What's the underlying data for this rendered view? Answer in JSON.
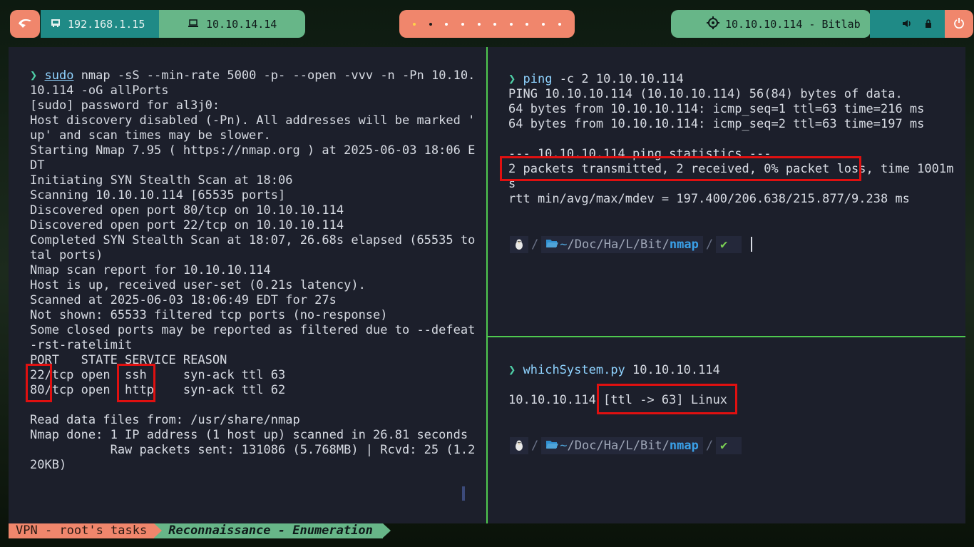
{
  "topbar": {
    "logo_icon": "kali-dragon-icon",
    "local_ip": "192.168.1.15",
    "local_icon": "network-card-icon",
    "vpn_ip": "10.10.14.14",
    "vpn_icon": "laptop-icon",
    "target": "10.10.10.114 - Bitlab",
    "target_icon": "crosshair-icon",
    "workspaces": [
      {
        "state": "active"
      },
      {
        "state": "current"
      },
      {
        "state": "empty"
      },
      {
        "state": "empty"
      },
      {
        "state": "empty"
      },
      {
        "state": "empty"
      },
      {
        "state": "empty"
      },
      {
        "state": "empty"
      },
      {
        "state": "empty"
      },
      {
        "state": "empty"
      }
    ],
    "volume_icon": "volume-icon",
    "lock_icon": "lock-icon",
    "power_icon": "power-icon"
  },
  "left_pane": {
    "cmd_arrow": "❯",
    "cmd_sudo": "sudo",
    "cmd_rest": " nmap -sS --min-rate 5000 -p- --open -vvv -n -Pn 10.10.",
    "lines": [
      "10.114 -oG allPorts",
      "[sudo] password for al3j0:",
      "Host discovery disabled (-Pn). All addresses will be marked '",
      "up' and scan times may be slower.",
      "Starting Nmap 7.95 ( https://nmap.org ) at 2025-06-03 18:06 E",
      "DT",
      "Initiating SYN Stealth Scan at 18:06",
      "Scanning 10.10.10.114 [65535 ports]",
      "Discovered open port 80/tcp on 10.10.10.114",
      "Discovered open port 22/tcp on 10.10.10.114",
      "Completed SYN Stealth Scan at 18:07, 26.68s elapsed (65535 to",
      "tal ports)",
      "Nmap scan report for 10.10.10.114",
      "Host is up, received user-set (0.21s latency).",
      "Scanned at 2025-06-03 18:06:49 EDT for 27s",
      "Not shown: 65533 filtered tcp ports (no-response)",
      "Some closed ports may be reported as filtered due to --defeat",
      "-rst-ratelimit",
      "PORT   STATE SERVICE REASON",
      "22/tcp open  ssh     syn-ack ttl 63",
      "80/tcp open  http    syn-ack ttl 62",
      "",
      "Read data files from: /usr/share/nmap",
      "Nmap done: 1 IP address (1 host up) scanned in 26.81 seconds",
      "           Raw packets sent: 131086 (5.768MB) | Rcvd: 25 (1.2",
      "20KB)"
    ]
  },
  "right_top_pane": {
    "cmd_arrow": "❯",
    "cmd_name": "ping",
    "cmd_rest": " -c 2 10.10.10.114",
    "lines": [
      "PING 10.10.10.114 (10.10.10.114) 56(84) bytes of data.",
      "64 bytes from 10.10.10.114: icmp_seq=1 ttl=63 time=216 ms",
      "64 bytes from 10.10.10.114: icmp_seq=2 ttl=63 time=197 ms",
      "",
      "--- 10.10.10.114 ping statistics ---",
      "2 packets transmitted, 2 received, 0% packet loss, time 1001m",
      "s",
      "rtt min/avg/max/mdev = 197.400/206.638/215.877/9.238 ms"
    ],
    "prompt": {
      "os_icon": "linux-tux-icon",
      "folder_icon": "folder-open-icon",
      "home": "~",
      "dirs": [
        "Doc",
        "Ha",
        "L",
        "Bit"
      ],
      "current": "nmap",
      "status": "✔"
    }
  },
  "right_bottom_pane": {
    "cmd_arrow": "❯",
    "cmd_name": "whichSystem.py",
    "cmd_rest": " 10.10.10.114",
    "lines": [
      "",
      "10.10.10.114 [ttl -> 63] Linux"
    ],
    "prompt": {
      "os_icon": "linux-tux-icon",
      "folder_icon": "folder-open-icon",
      "home": "~",
      "dirs": [
        "Doc",
        "Ha",
        "L",
        "Bit"
      ],
      "current": "nmap",
      "status": "✔"
    }
  },
  "statusbar": {
    "session": "VPN - root's tasks",
    "window": "Reconnaissance - Enumeration"
  }
}
